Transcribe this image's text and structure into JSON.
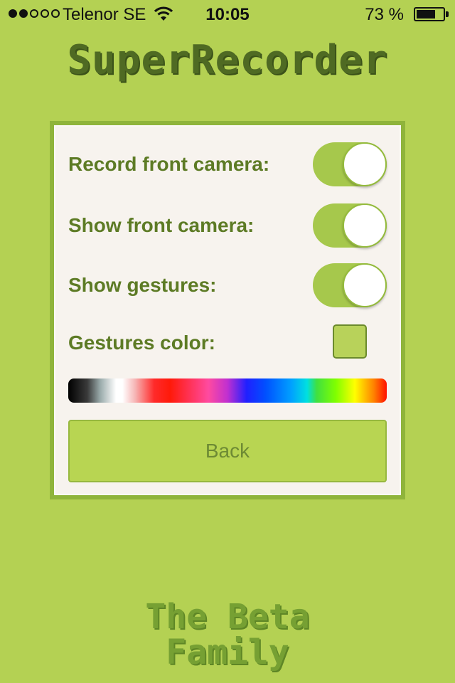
{
  "status_bar": {
    "carrier": "Telenor SE",
    "time": "10:05",
    "battery_text": "73 %",
    "battery_level": 0.73,
    "signal_bars_filled": 2,
    "signal_bars_total": 5
  },
  "app": {
    "title": "SuperRecorder",
    "footer": "The Beta\nFamily"
  },
  "settings": {
    "record_front_camera": {
      "label": "Record front camera:",
      "on": true
    },
    "show_front_camera": {
      "label": "Show front camera:",
      "on": true
    },
    "show_gestures": {
      "label": "Show gestures:",
      "on": true
    },
    "gestures_color": {
      "label": "Gestures color:",
      "value": "#b8d25a"
    }
  },
  "back_button": {
    "label": "Back"
  },
  "colors": {
    "background": "#b4d153",
    "panel": "#f7f3ee",
    "label": "#5d7b25",
    "accent": "#a6c84c"
  },
  "icons": [
    "signal-dots-icon",
    "wifi-icon",
    "battery-icon"
  ]
}
